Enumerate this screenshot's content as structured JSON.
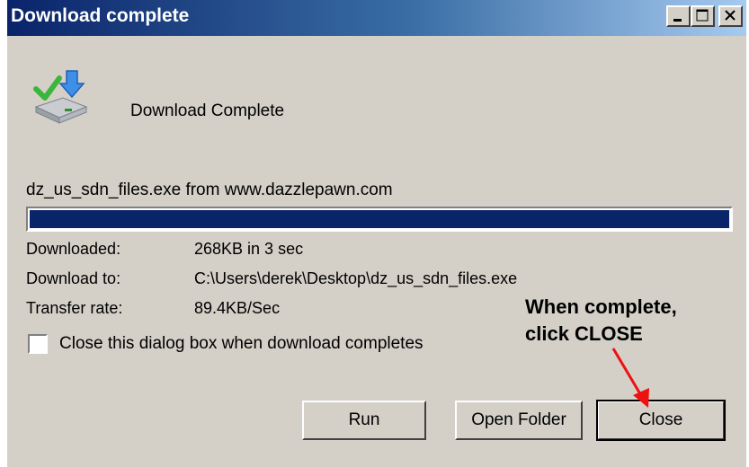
{
  "window": {
    "title": "Download complete",
    "controls": [
      "minimize",
      "maximize",
      "close"
    ]
  },
  "header": {
    "icon": "download-complete-icon",
    "text": "Download Complete"
  },
  "source_text": "dz_us_sdn_files.exe from www.dazzlepawn.com",
  "progress": {
    "percent": 100,
    "color": "#0a246a"
  },
  "info": [
    {
      "label": "Downloaded:",
      "value": "268KB in 3 sec"
    },
    {
      "label": "Download to:",
      "value": "C:\\Users\\derek\\Desktop\\dz_us_sdn_files.exe"
    },
    {
      "label": "Transfer rate:",
      "value": "89.4KB/Sec"
    }
  ],
  "checkbox": {
    "label": "Close this dialog box when download completes",
    "checked": false
  },
  "annotation": {
    "line1": "When complete,",
    "line2": "click CLOSE",
    "arrow_color": "#ee1111"
  },
  "buttons": {
    "run": "Run",
    "open_folder": "Open Folder",
    "close": "Close"
  }
}
